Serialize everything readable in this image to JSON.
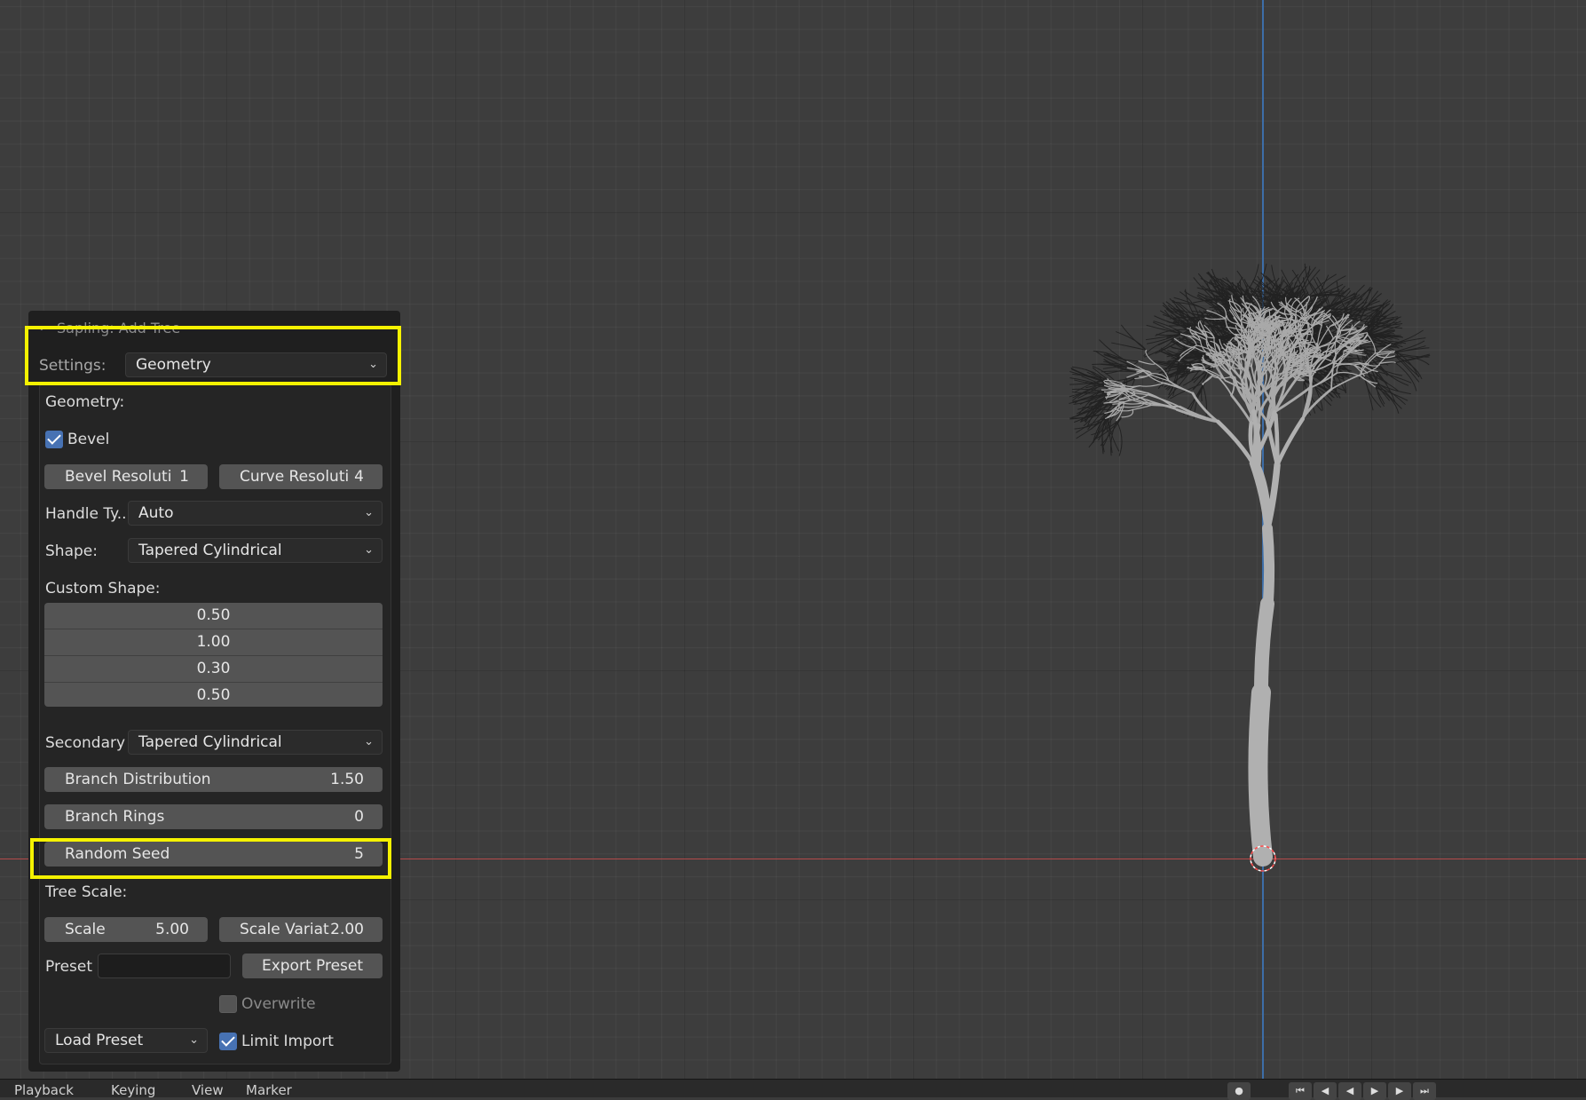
{
  "panel": {
    "title": "Sapling: Add Tree",
    "settings_label": "Settings:",
    "settings_value": "Geometry",
    "section_geometry": "Geometry:",
    "bevel_label": "Bevel",
    "bevel_checked": true,
    "bevel_resolution": {
      "label": "Bevel Resoluti",
      "value": "1"
    },
    "curve_resolution": {
      "label": "Curve Resoluti",
      "value": "4"
    },
    "handle_type_label": "Handle Ty...",
    "handle_type_value": "Auto",
    "shape_label": "Shape:",
    "shape_value": "Tapered Cylindrical",
    "custom_shape_label": "Custom Shape:",
    "custom_shape_values": [
      "0.50",
      "1.00",
      "0.30",
      "0.50"
    ],
    "secondary_label": "Secondary",
    "secondary_value": "Tapered Cylindrical",
    "branch_distribution": {
      "label": "Branch Distribution",
      "value": "1.50"
    },
    "branch_rings": {
      "label": "Branch Rings",
      "value": "0"
    },
    "random_seed": {
      "label": "Random Seed",
      "value": "5"
    },
    "tree_scale_label": "Tree Scale:",
    "scale": {
      "label": "Scale",
      "value": "5.00"
    },
    "scale_variation": {
      "label": "Scale Variat",
      "value": "2.00"
    },
    "preset_label": "Preset",
    "preset_value": "",
    "export_preset_label": "Export Preset",
    "overwrite_label": "Overwrite",
    "overwrite_checked": false,
    "load_preset_label": "Load Preset",
    "limit_import_label": "Limit Import",
    "limit_import_checked": true
  },
  "timeline": {
    "menu_items": [
      "Playback",
      "Keying",
      "View",
      "Marker"
    ]
  },
  "icons": {
    "collapse": "chevron-down-icon",
    "dropdown": "chevron-down-icon",
    "origin": "object-origin-icon"
  },
  "colors": {
    "highlight": "#f5f200",
    "checkbox_on": "#4772b3",
    "x_axis": "#b34a4a",
    "y_axis": "#3d6ea8"
  }
}
